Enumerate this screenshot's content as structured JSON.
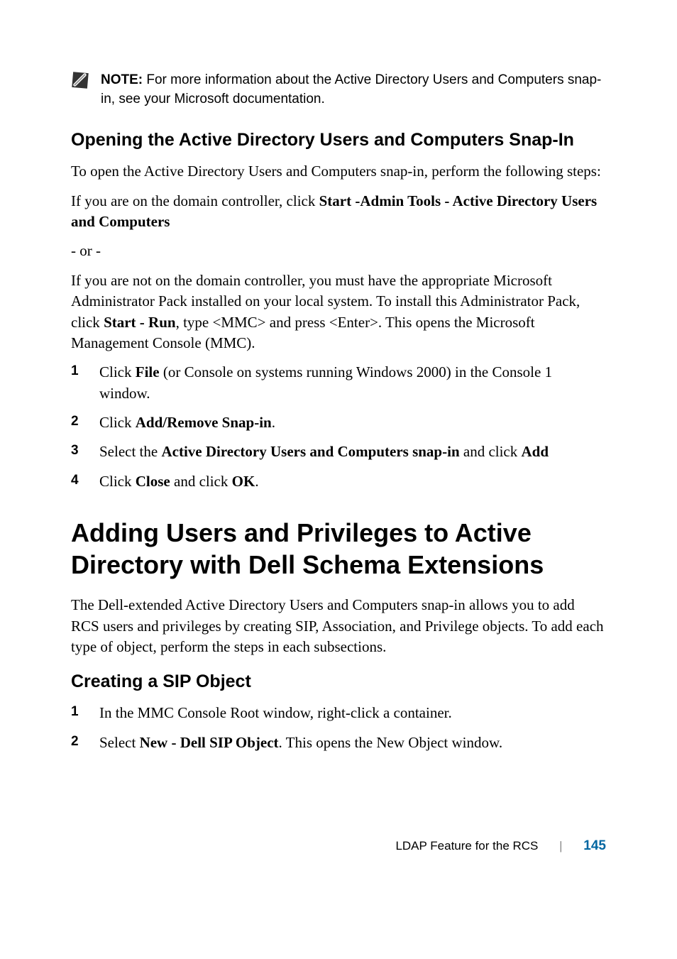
{
  "note": {
    "label": "NOTE:",
    "text": " For more information about the Active Directory Users and Computers snap-in, see your Microsoft documentation."
  },
  "section1": {
    "heading": "Opening the Active Directory Users and Computers Snap-In",
    "p1": "To open the Active Directory Users and Computers snap-in, perform the following steps:",
    "p2_prefix": "If you are on the domain controller, click ",
    "p2_bold": "Start -Admin Tools - Active Directory Users and Computers",
    "p3": "- or -",
    "p4_prefix": "If you are not on the domain controller, you must have the appropriate Microsoft Administrator Pack installed on your local system. To install this Administrator Pack, click ",
    "p4_bold": "Start - Run",
    "p4_suffix": ", type <MMC> and press <Enter>. This opens the Microsoft Management Console (MMC).",
    "steps": {
      "s1_prefix": "Click ",
      "s1_bold": "File",
      "s1_suffix": " (or Console on systems running Windows 2000) in the Console 1 window.",
      "s2_prefix": "Click ",
      "s2_bold": "Add/Remove Snap-in",
      "s2_suffix": ".",
      "s3_prefix": "Select the ",
      "s3_bold1": "Active Directory Users and Computers snap-in",
      "s3_mid": " and click ",
      "s3_bold2": "Add",
      "s4_prefix": "Click ",
      "s4_bold1": "Close",
      "s4_mid": " and click ",
      "s4_bold2": "OK",
      "s4_suffix": "."
    }
  },
  "section2": {
    "heading": "Adding Users and Privileges to Active Directory with Dell Schema Extensions",
    "p1": "The Dell-extended Active Directory Users and Computers snap-in allows you to add RCS users and privileges by creating SIP, Association, and Privilege objects. To add each type of object, perform the steps in each subsections."
  },
  "section3": {
    "heading": "Creating a SIP Object",
    "steps": {
      "s1": "In the MMC Console Root window, right-click a container.",
      "s2_prefix": "Select ",
      "s2_bold": "New - Dell SIP Object",
      "s2_suffix": ". This opens the New Object window."
    }
  },
  "footer": {
    "title": "LDAP Feature for the RCS",
    "page": "145"
  }
}
